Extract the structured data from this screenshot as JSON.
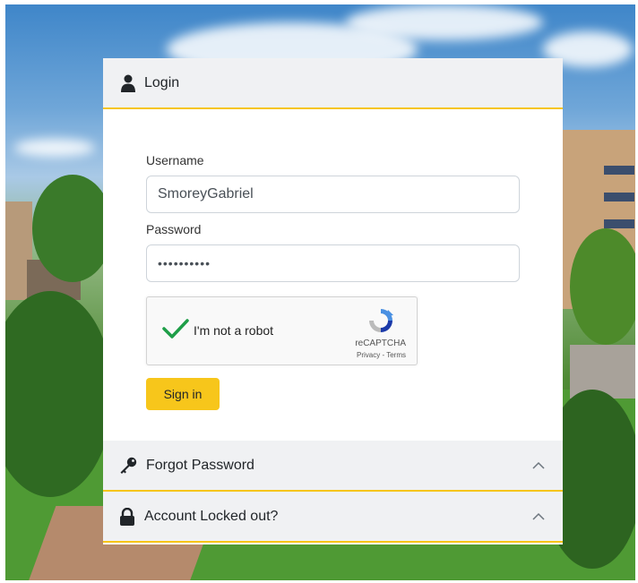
{
  "login": {
    "title": "Login",
    "username_label": "Username",
    "username_value": "SmoreyGabriel",
    "password_label": "Password",
    "password_value": "••••••••••",
    "captcha": {
      "text": "I'm not a robot",
      "brand": "reCAPTCHA",
      "links": "Privacy - Terms"
    },
    "signin_label": "Sign in"
  },
  "sections": [
    {
      "label": "Forgot Password",
      "icon": "key-icon"
    },
    {
      "label": "Account Locked out?",
      "icon": "lock-icon"
    }
  ],
  "colors": {
    "accent": "#f6c518",
    "header_bg": "#f0f1f3",
    "check_green": "#1e9e48"
  }
}
